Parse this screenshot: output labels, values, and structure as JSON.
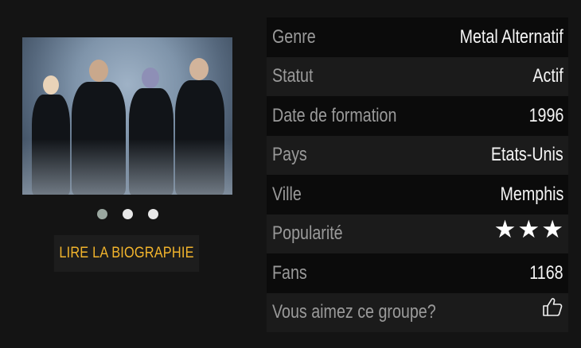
{
  "biography_button": {
    "label": "LIRE LA BIOGRAPHIE"
  },
  "carousel": {
    "dots": 3,
    "active_index": 0
  },
  "info": {
    "rows": [
      {
        "label": "Genre",
        "value": "Metal Alternatif"
      },
      {
        "label": "Statut",
        "value": "Actif"
      },
      {
        "label": "Date de formation",
        "value": "1996"
      },
      {
        "label": "Pays",
        "value": "Etats-Unis"
      },
      {
        "label": "Ville",
        "value": "Memphis"
      },
      {
        "label": "Popularité",
        "rating": 3,
        "max": 3
      },
      {
        "label": "Fans",
        "value": "1168"
      },
      {
        "label": "Vous aimez ce groupe?",
        "icon": "thumbs-up-icon"
      }
    ]
  },
  "colors": {
    "background": "#141414",
    "accent": "#f2b42c",
    "row_dark": "#0b0b0b",
    "row_light": "#1b1b1b"
  }
}
